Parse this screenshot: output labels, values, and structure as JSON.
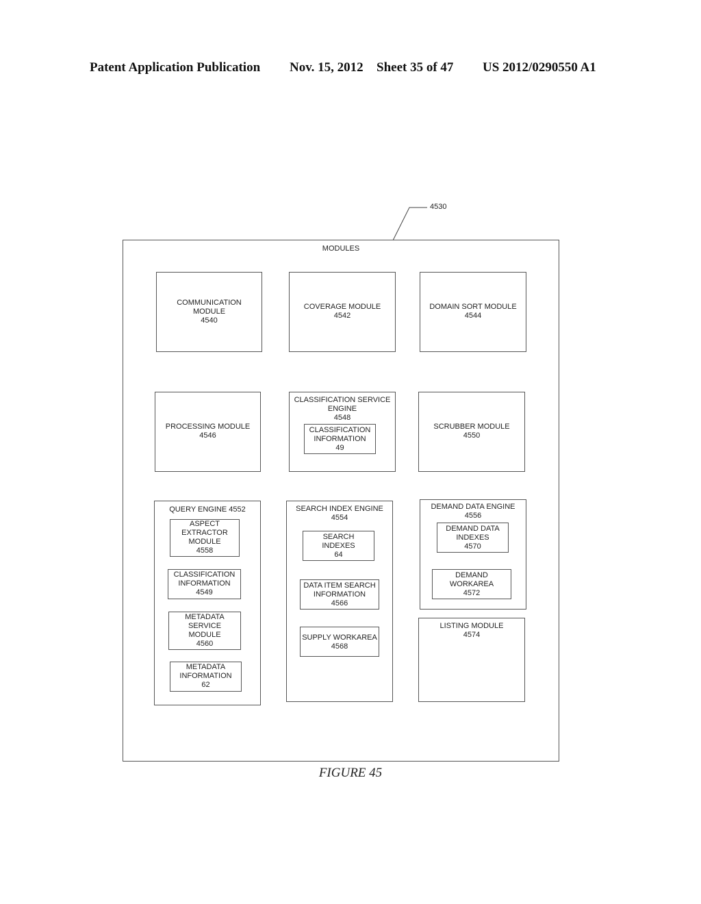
{
  "header": {
    "publication": "Patent Application Publication",
    "date": "Nov. 15, 2012",
    "sheet": "Sheet 35 of 47",
    "number": "US 2012/0290550 A1"
  },
  "figure": {
    "reference": "4530",
    "container_label": "MODULES",
    "caption": "FIGURE 45",
    "modules": {
      "communication": "COMMUNICATION\nMODULE\n4540",
      "coverage": "COVERAGE MODULE\n4542",
      "domain_sort": "DOMAIN SORT MODULE\n4544",
      "processing": "PROCESSING MODULE\n4546",
      "classification_service": "CLASSIFICATION SERVICE\nENGINE\n4548",
      "classification_info_49": "CLASSIFICATION\nINFORMATION\n49",
      "scrubber": "SCRUBBER MODULE\n4550",
      "query_engine": "QUERY ENGINE 4552",
      "aspect_extractor": "ASPECT\nEXTRACTOR\nMODULE\n4558",
      "classification_info_4549": "CLASSIFICATION\nINFORMATION\n4549",
      "metadata_service": "METADATA\nSERVICE\nMODULE\n4560",
      "metadata_info": "METADATA\nINFORMATION\n62",
      "search_index_engine": "SEARCH INDEX ENGINE\n4554",
      "search_indexes": "SEARCH\nINDEXES\n64",
      "data_item_search": "DATA ITEM SEARCH\nINFORMATION\n4566",
      "supply_workarea": "SUPPLY WORKAREA\n4568",
      "demand_data_engine": "DEMAND DATA ENGINE\n4556",
      "demand_data_indexes": "DEMAND DATA\nINDEXES\n4570",
      "demand_workarea": "DEMAND\nWORKAREA\n4572",
      "listing": "LISTING MODULE\n4574"
    }
  }
}
